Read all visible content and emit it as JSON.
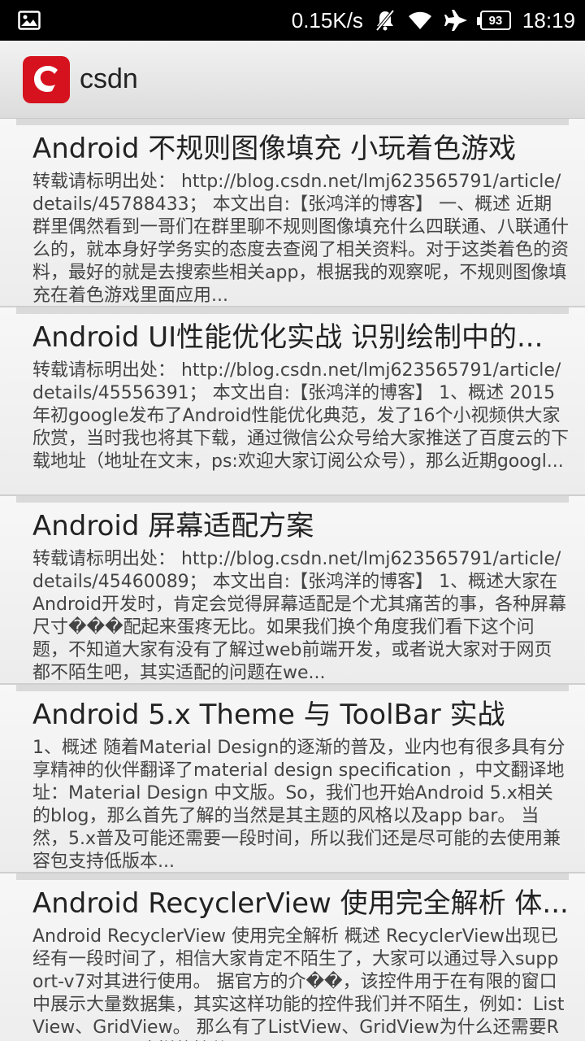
{
  "status_bar": {
    "speed": "0.15K/s",
    "battery": "93",
    "time": "18:19",
    "icons": [
      "image-icon",
      "silent-icon",
      "wifi-icon",
      "airplane-icon",
      "battery-icon"
    ]
  },
  "app_bar": {
    "title": "csdn",
    "logo_icon": "csdn-logo-icon",
    "brand_color": "#d5121e"
  },
  "articles": [
    {
      "title": "Android 不规则图像填充 小玩着色游戏",
      "summary": "转载请标明出处： http://blog.csdn.net/lmj623565791/article/details/45788433； 本文出自:【张鸿洋的博客】 一、概述 近期群里偶然看到一哥们在群里聊不规则图像填充什么四联通、八联通什么的，就本身好学务实的态度去查阅了相关资料。对于这类着色的资料，最好的就是去搜索些相关app，根据我的观察呢，不规则图像填充在着色游戏里面应用..."
    },
    {
      "title": "Android UI性能优化实战 识别绘制中的...",
      "summary": "转载请标明出处： http://blog.csdn.net/lmj623565791/article/details/45556391； 本文出自:【张鸿洋的博客】 1、概述 2015年初google发布了Android性能优化典范，发了16个小视频供大家欣赏，当时我也将其下载，通过微信公众号给大家推送了百度云的下载地址（地址在文末，ps:欢迎大家订阅公众号），那么近期googl..."
    },
    {
      "title": "Android 屏幕适配方案",
      "summary": "转载请标明出处： http://blog.csdn.net/lmj623565791/article/details/45460089； 本文出自:【张鸿洋的博客】 1、概述大家在Android开发时，肯定会觉得屏幕适配是个尤其痛苦的事，各种屏幕尺寸���配起来蛋疼无比。如果我们换个角度我们看下这个问题，不知道大家有没有了解过web前端开发，或者说大家对于网页都不陌生吧，其实适配的问题在we..."
    },
    {
      "title": "Android 5.x Theme 与 ToolBar 实战",
      "summary": "1、概述 随着Material Design的逐渐的普及，业内也有很多具有分享精神的伙伴翻译了material design specification ，中文翻译地址：Material Design 中文版。So，我们也开始Android 5.x相关的blog，那么首先了解的当然是其主题的风格以及app bar。 当然，5.x普及可能还需要一段时间，所以我们还是尽可能的去使用兼容包支持低版本..."
    },
    {
      "title": "Android RecyclerView 使用完全解析 体...",
      "summary": "Android RecyclerView 使用完全解析 概述 RecyclerView出现已经有一段时间了，相信大家肯定不陌生了，大家可以通过导入support-v7对其进行使用。 据官方的介��，该控件用于在有限的窗口中展示大量数据集，其实这样功能的控件我们并不陌生，例如：ListView、GridView。 那么有了ListView、GridView为什么还需要RecyclerView这样的控件呢..."
    }
  ]
}
